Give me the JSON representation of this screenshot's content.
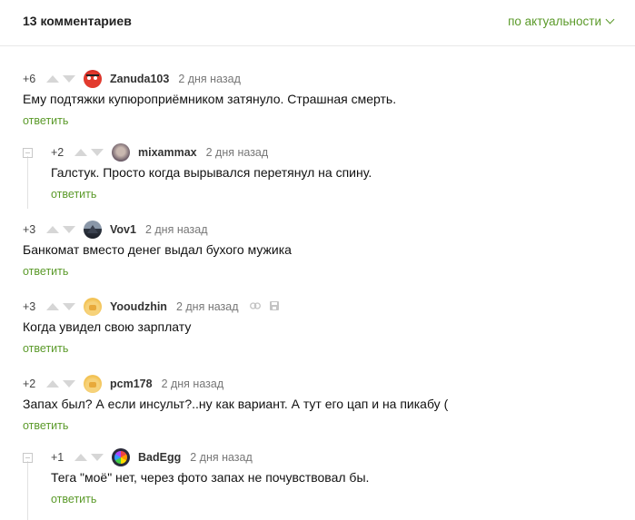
{
  "header": {
    "count": "13 комментариев",
    "sort": "по актуальности"
  },
  "reply_label": "ответить",
  "comments": [
    {
      "rating": "+6",
      "user": "Zanuda103",
      "time": "2 дня назад",
      "text": "Ему подтяжки купюроприёмником затянуло. Страшная смерть."
    },
    {
      "rating": "+2",
      "user": "mixammax",
      "time": "2 дня назад",
      "text": "Галстук. Просто когда вырывался перетянул на спину."
    },
    {
      "rating": "+3",
      "user": "Vov1",
      "time": "2 дня назад",
      "text": "Банкомат вместо денег выдал бухого мужика"
    },
    {
      "rating": "+3",
      "user": "Yooudzhin",
      "time": "2 дня назад",
      "text": "Когда увидел свою зарплату"
    },
    {
      "rating": "+2",
      "user": "pcm178",
      "time": "2 дня назад",
      "text": "Запах был? А если инсульт?..ну как вариант. А тут его цап и на пикабу ("
    },
    {
      "rating": "+1",
      "user": "BadEgg",
      "time": "2 дня назад",
      "text": "Тега \"моё\" нет, через фото запах не почувствовал бы."
    }
  ],
  "colors": {
    "accent": "#5b9a2a",
    "vote": "#d6d6d6"
  }
}
